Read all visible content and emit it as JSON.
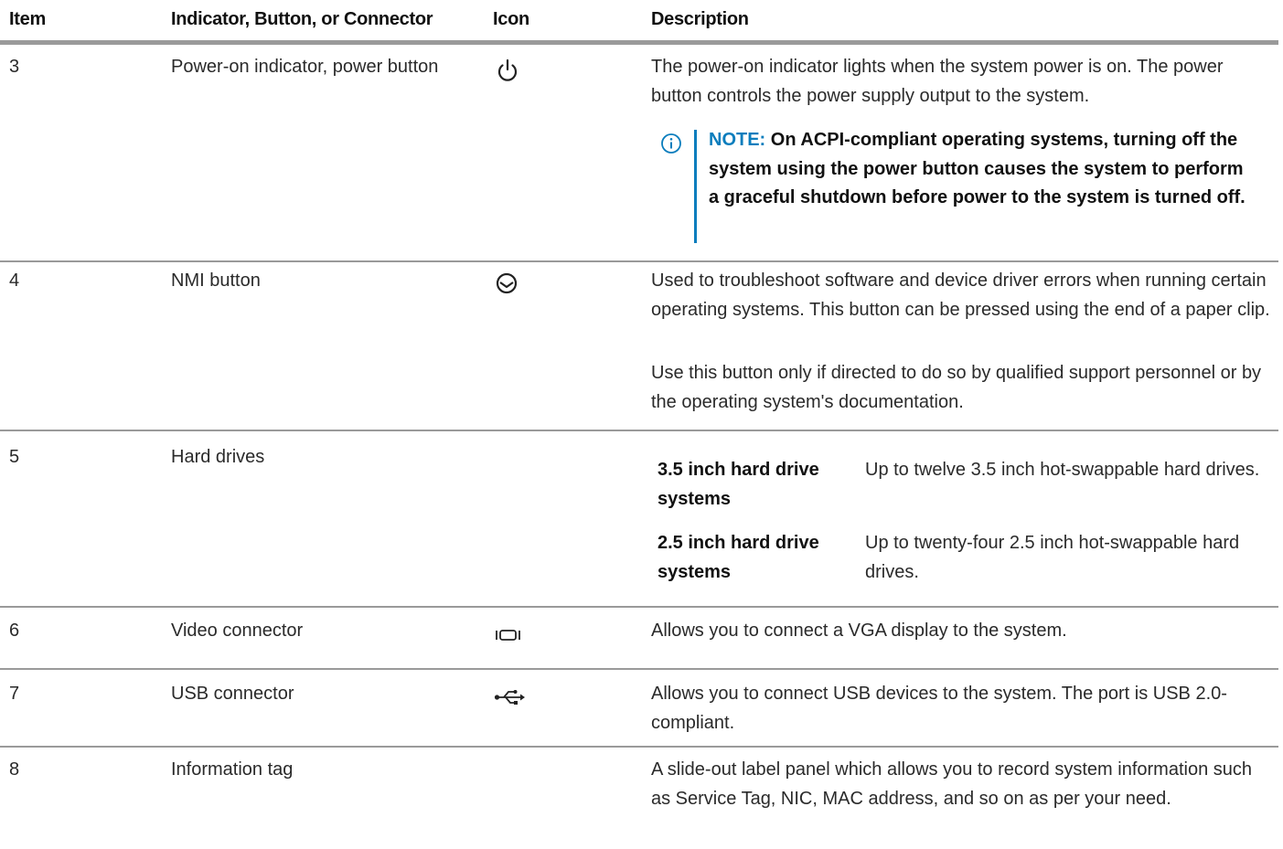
{
  "header": {
    "item": "Item",
    "component": "Indicator, Button, or Connector",
    "icon": "Icon",
    "description": "Description"
  },
  "rows": [
    {
      "item": "3",
      "name": "Power-on indicator, power button",
      "icon": "power-icon",
      "description": [
        "The power-on indicator lights when the system power is on. The power button controls the power supply output to the system."
      ],
      "note": {
        "label": "NOTE:",
        "text": "On ACPI-compliant operating systems, turning off the system using the power button causes the system to perform a graceful shutdown before power to the system is turned off."
      }
    },
    {
      "item": "4",
      "name": "NMI button",
      "icon": "nmi-icon",
      "description": [
        "Used to troubleshoot software and device driver errors when running certain operating systems. This button can be pressed using the end of a paper clip.",
        "Use this button only if directed to do so by qualified support personnel or by the operating system's documentation."
      ]
    },
    {
      "item": "5",
      "name": "Hard drives",
      "icon": "",
      "subtable": [
        {
          "key": "3.5 inch hard drive systems",
          "value": "Up to twelve 3.5 inch hot-swappable hard drives."
        },
        {
          "key": "2.5 inch hard drive systems",
          "value": "Up to twenty-four 2.5 inch hot-swappable hard drives."
        }
      ]
    },
    {
      "item": "6",
      "name": "Video connector",
      "icon": "vga-icon",
      "description": [
        "Allows you to connect a VGA display to the system."
      ]
    },
    {
      "item": "7",
      "name": "USB connector",
      "icon": "usb-icon",
      "description": [
        "Allows you to connect USB devices to the system. The port is USB 2.0-compliant."
      ]
    },
    {
      "item": "8",
      "name": "Information tag",
      "icon": "",
      "description": [
        "A slide-out label panel which allows you to record system information such as Service Tag, NIC, MAC address, and so on as per your need."
      ]
    }
  ],
  "colors": {
    "note_accent": "#0a7dbd",
    "rule": "#9a9a9a"
  }
}
